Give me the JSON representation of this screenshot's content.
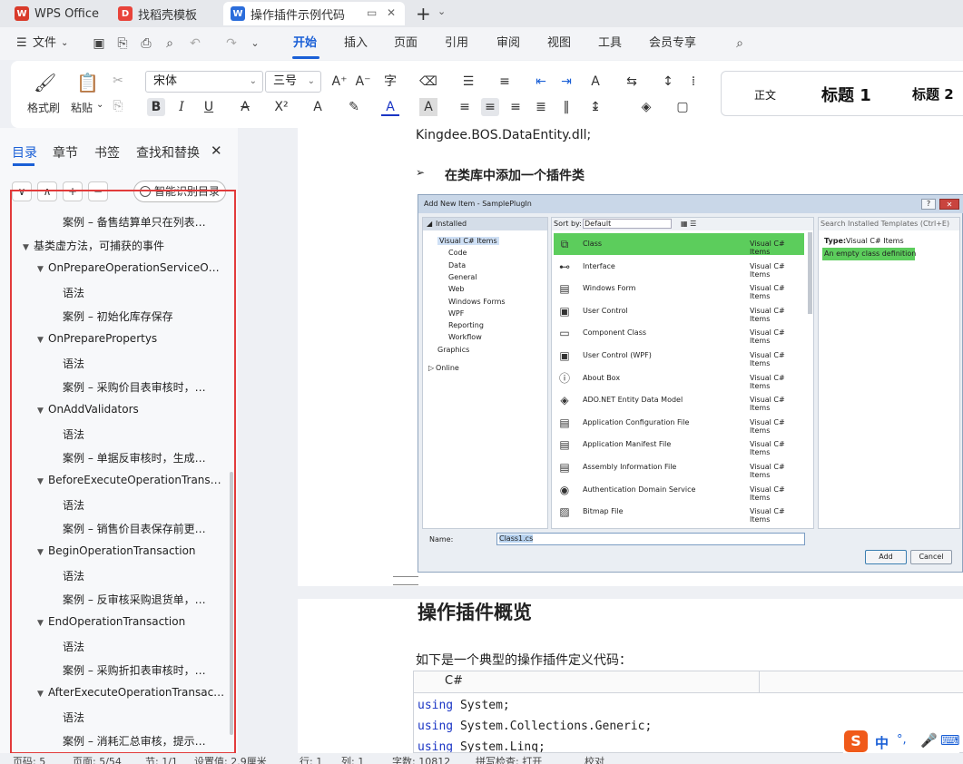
{
  "tabs": [
    {
      "label": "WPS Office",
      "icon": "wps-logo-icon",
      "color": "#d93b2b"
    },
    {
      "label": "找稻壳模板",
      "icon": "docer-logo-icon",
      "color": "#e8433a"
    },
    {
      "label": "操作插件示例代码",
      "icon": "word-doc-icon",
      "color": "#2b6ddb"
    }
  ],
  "menu": {
    "file": "文件",
    "items": [
      "开始",
      "插入",
      "页面",
      "引用",
      "审阅",
      "视图",
      "工具",
      "会员专享"
    ],
    "active": "开始"
  },
  "ribbon": {
    "format_painter": "格式刷",
    "paste": "粘贴",
    "font_name": "宋体",
    "font_size": "三号",
    "styles": [
      "正文",
      "标题 1",
      "标题 2"
    ]
  },
  "left_panel": {
    "tabs": [
      "目录",
      "章节",
      "书签",
      "查找和替换"
    ],
    "active_tab": "目录",
    "buttons": [
      "∨",
      "∧",
      "+",
      "−"
    ],
    "smart_toc": "智能识别目录",
    "toc_items": [
      {
        "level": 3,
        "text": "案例 – 备售结算单只在列表…",
        "caret": false
      },
      {
        "level": 1,
        "text": "基类虚方法，可捕获的事件",
        "caret": true
      },
      {
        "level": 2,
        "text": "OnPrepareOperationServiceO…",
        "caret": true
      },
      {
        "level": 3,
        "text": "语法",
        "caret": false
      },
      {
        "level": 3,
        "text": "案例 – 初始化库存保存",
        "caret": false
      },
      {
        "level": 2,
        "text": "OnPreparePropertys",
        "caret": true
      },
      {
        "level": 3,
        "text": "语法",
        "caret": false
      },
      {
        "level": 3,
        "text": "案例 – 采购价目表审核时，…",
        "caret": false
      },
      {
        "level": 2,
        "text": "OnAddValidators",
        "caret": true
      },
      {
        "level": 3,
        "text": "语法",
        "caret": false
      },
      {
        "level": 3,
        "text": "案例 – 单据反审核时，生成…",
        "caret": false
      },
      {
        "level": 2,
        "text": "BeforeExecuteOperationTrans…",
        "caret": true
      },
      {
        "level": 3,
        "text": "语法",
        "caret": false
      },
      {
        "level": 3,
        "text": "案例 – 销售价目表保存前更…",
        "caret": false
      },
      {
        "level": 2,
        "text": "BeginOperationTransaction",
        "caret": true
      },
      {
        "level": 3,
        "text": "语法",
        "caret": false
      },
      {
        "level": 3,
        "text": "案例 – 反审核采购退货单，…",
        "caret": false
      },
      {
        "level": 2,
        "text": "EndOperationTransaction",
        "caret": true
      },
      {
        "level": 3,
        "text": "语法",
        "caret": false
      },
      {
        "level": 3,
        "text": "案例 – 采购折扣表审核时，…",
        "caret": false
      },
      {
        "level": 2,
        "text": "AfterExecuteOperationTransac…",
        "caret": true
      },
      {
        "level": 3,
        "text": "语法",
        "caret": false
      },
      {
        "level": 3,
        "text": "案例 – 消耗汇总审核，提示…",
        "caret": false
      }
    ]
  },
  "doc": {
    "line1": "Kingdee.BOS.DataEntity.dll;",
    "bullet": "在类库中添加一个插件类",
    "bullet_marker": "➢",
    "heading": "操作插件概览",
    "intro": "如下是一个典型的操作插件定义代码：",
    "code_lang": "C#",
    "code_lines": [
      {
        "kw": "using",
        "rest": " System;"
      },
      {
        "kw": "using",
        "rest": " System.Collections.Generic;"
      },
      {
        "kw": "using",
        "rest": " System.Linq;"
      }
    ]
  },
  "dialog": {
    "title": "Add New Item - SamplePlugIn",
    "installed": "Installed",
    "sort_by": "Sort by:",
    "sort_value": "Default",
    "search_placeholder": "Search Installed Templates (Ctrl+E)",
    "tree": [
      {
        "text": "Visual C# Items",
        "level": 1,
        "selected": true
      },
      {
        "text": "Code",
        "level": 2
      },
      {
        "text": "Data",
        "level": 2
      },
      {
        "text": "General",
        "level": 2
      },
      {
        "text": "Web",
        "level": 2
      },
      {
        "text": "Windows Forms",
        "level": 2
      },
      {
        "text": "WPF",
        "level": 2
      },
      {
        "text": "Reporting",
        "level": 2
      },
      {
        "text": "Workflow",
        "level": 2
      },
      {
        "text": "Graphics",
        "level": 1
      }
    ],
    "online": "Online",
    "items": [
      {
        "name": "Class",
        "cat": "Visual C# Items",
        "selected": true
      },
      {
        "name": "Interface",
        "cat": "Visual C# Items"
      },
      {
        "name": "Windows Form",
        "cat": "Visual C# Items"
      },
      {
        "name": "User Control",
        "cat": "Visual C# Items"
      },
      {
        "name": "Component Class",
        "cat": "Visual C# Items"
      },
      {
        "name": "User Control (WPF)",
        "cat": "Visual C# Items"
      },
      {
        "name": "About Box",
        "cat": "Visual C# Items"
      },
      {
        "name": "ADO.NET Entity Data Model",
        "cat": "Visual C# Items"
      },
      {
        "name": "Application Configuration File",
        "cat": "Visual C# Items"
      },
      {
        "name": "Application Manifest File",
        "cat": "Visual C# Items"
      },
      {
        "name": "Assembly Information File",
        "cat": "Visual C# Items"
      },
      {
        "name": "Authentication Domain Service",
        "cat": "Visual C# Items"
      },
      {
        "name": "Bitmap File",
        "cat": "Visual C# Items"
      }
    ],
    "type_label": "Type:",
    "type_value": "Visual C# Items",
    "description": "An empty class definition",
    "name_label": "Name:",
    "name_value": "Class1.cs",
    "add": "Add",
    "cancel": "Cancel"
  },
  "status": {
    "page": "页码: 5",
    "pages": "页面: 5/54",
    "section": "节: 1/1",
    "setting": "设置值: 2.9厘米",
    "row": "行: 1",
    "col": "列: 1",
    "words": "字数: 10812",
    "spell": "拼写检查: 打开",
    "proof": "校对"
  },
  "ime": {
    "lang": "中",
    "punct": "°,"
  },
  "colors": {
    "accent": "#1a5fd6",
    "highlight": "#e23b3b",
    "selected_item": "#5ccd5c"
  }
}
